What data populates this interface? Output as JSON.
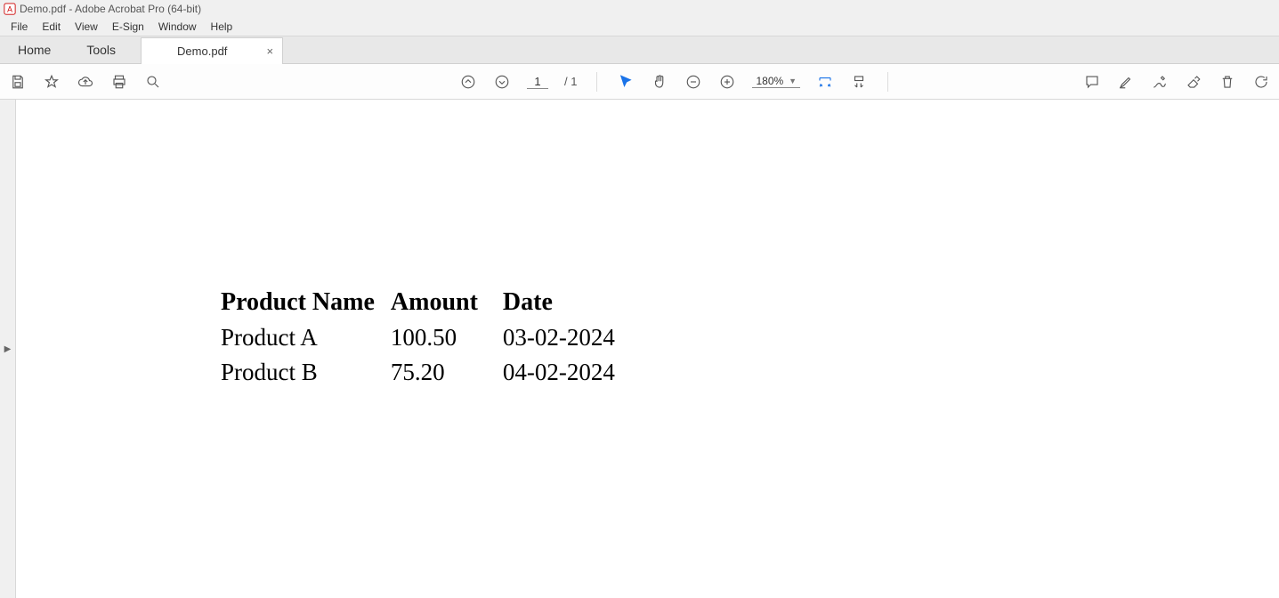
{
  "window": {
    "title": "Demo.pdf - Adobe Acrobat Pro (64-bit)"
  },
  "menu": {
    "items": [
      "File",
      "Edit",
      "View",
      "E-Sign",
      "Window",
      "Help"
    ]
  },
  "tabs": {
    "home": "Home",
    "tools": "Tools",
    "doc": "Demo.pdf",
    "close": "×"
  },
  "toolbar": {
    "page_current": "1",
    "page_total": "/ 1",
    "zoom": "180%"
  },
  "document": {
    "headers": [
      "Product Name",
      "Amount",
      "Date"
    ],
    "rows": [
      {
        "name": "Product A",
        "amount": "100.50",
        "date": "03-02-2024"
      },
      {
        "name": "Product B",
        "amount": "75.20",
        "date": "04-02-2024"
      }
    ]
  }
}
